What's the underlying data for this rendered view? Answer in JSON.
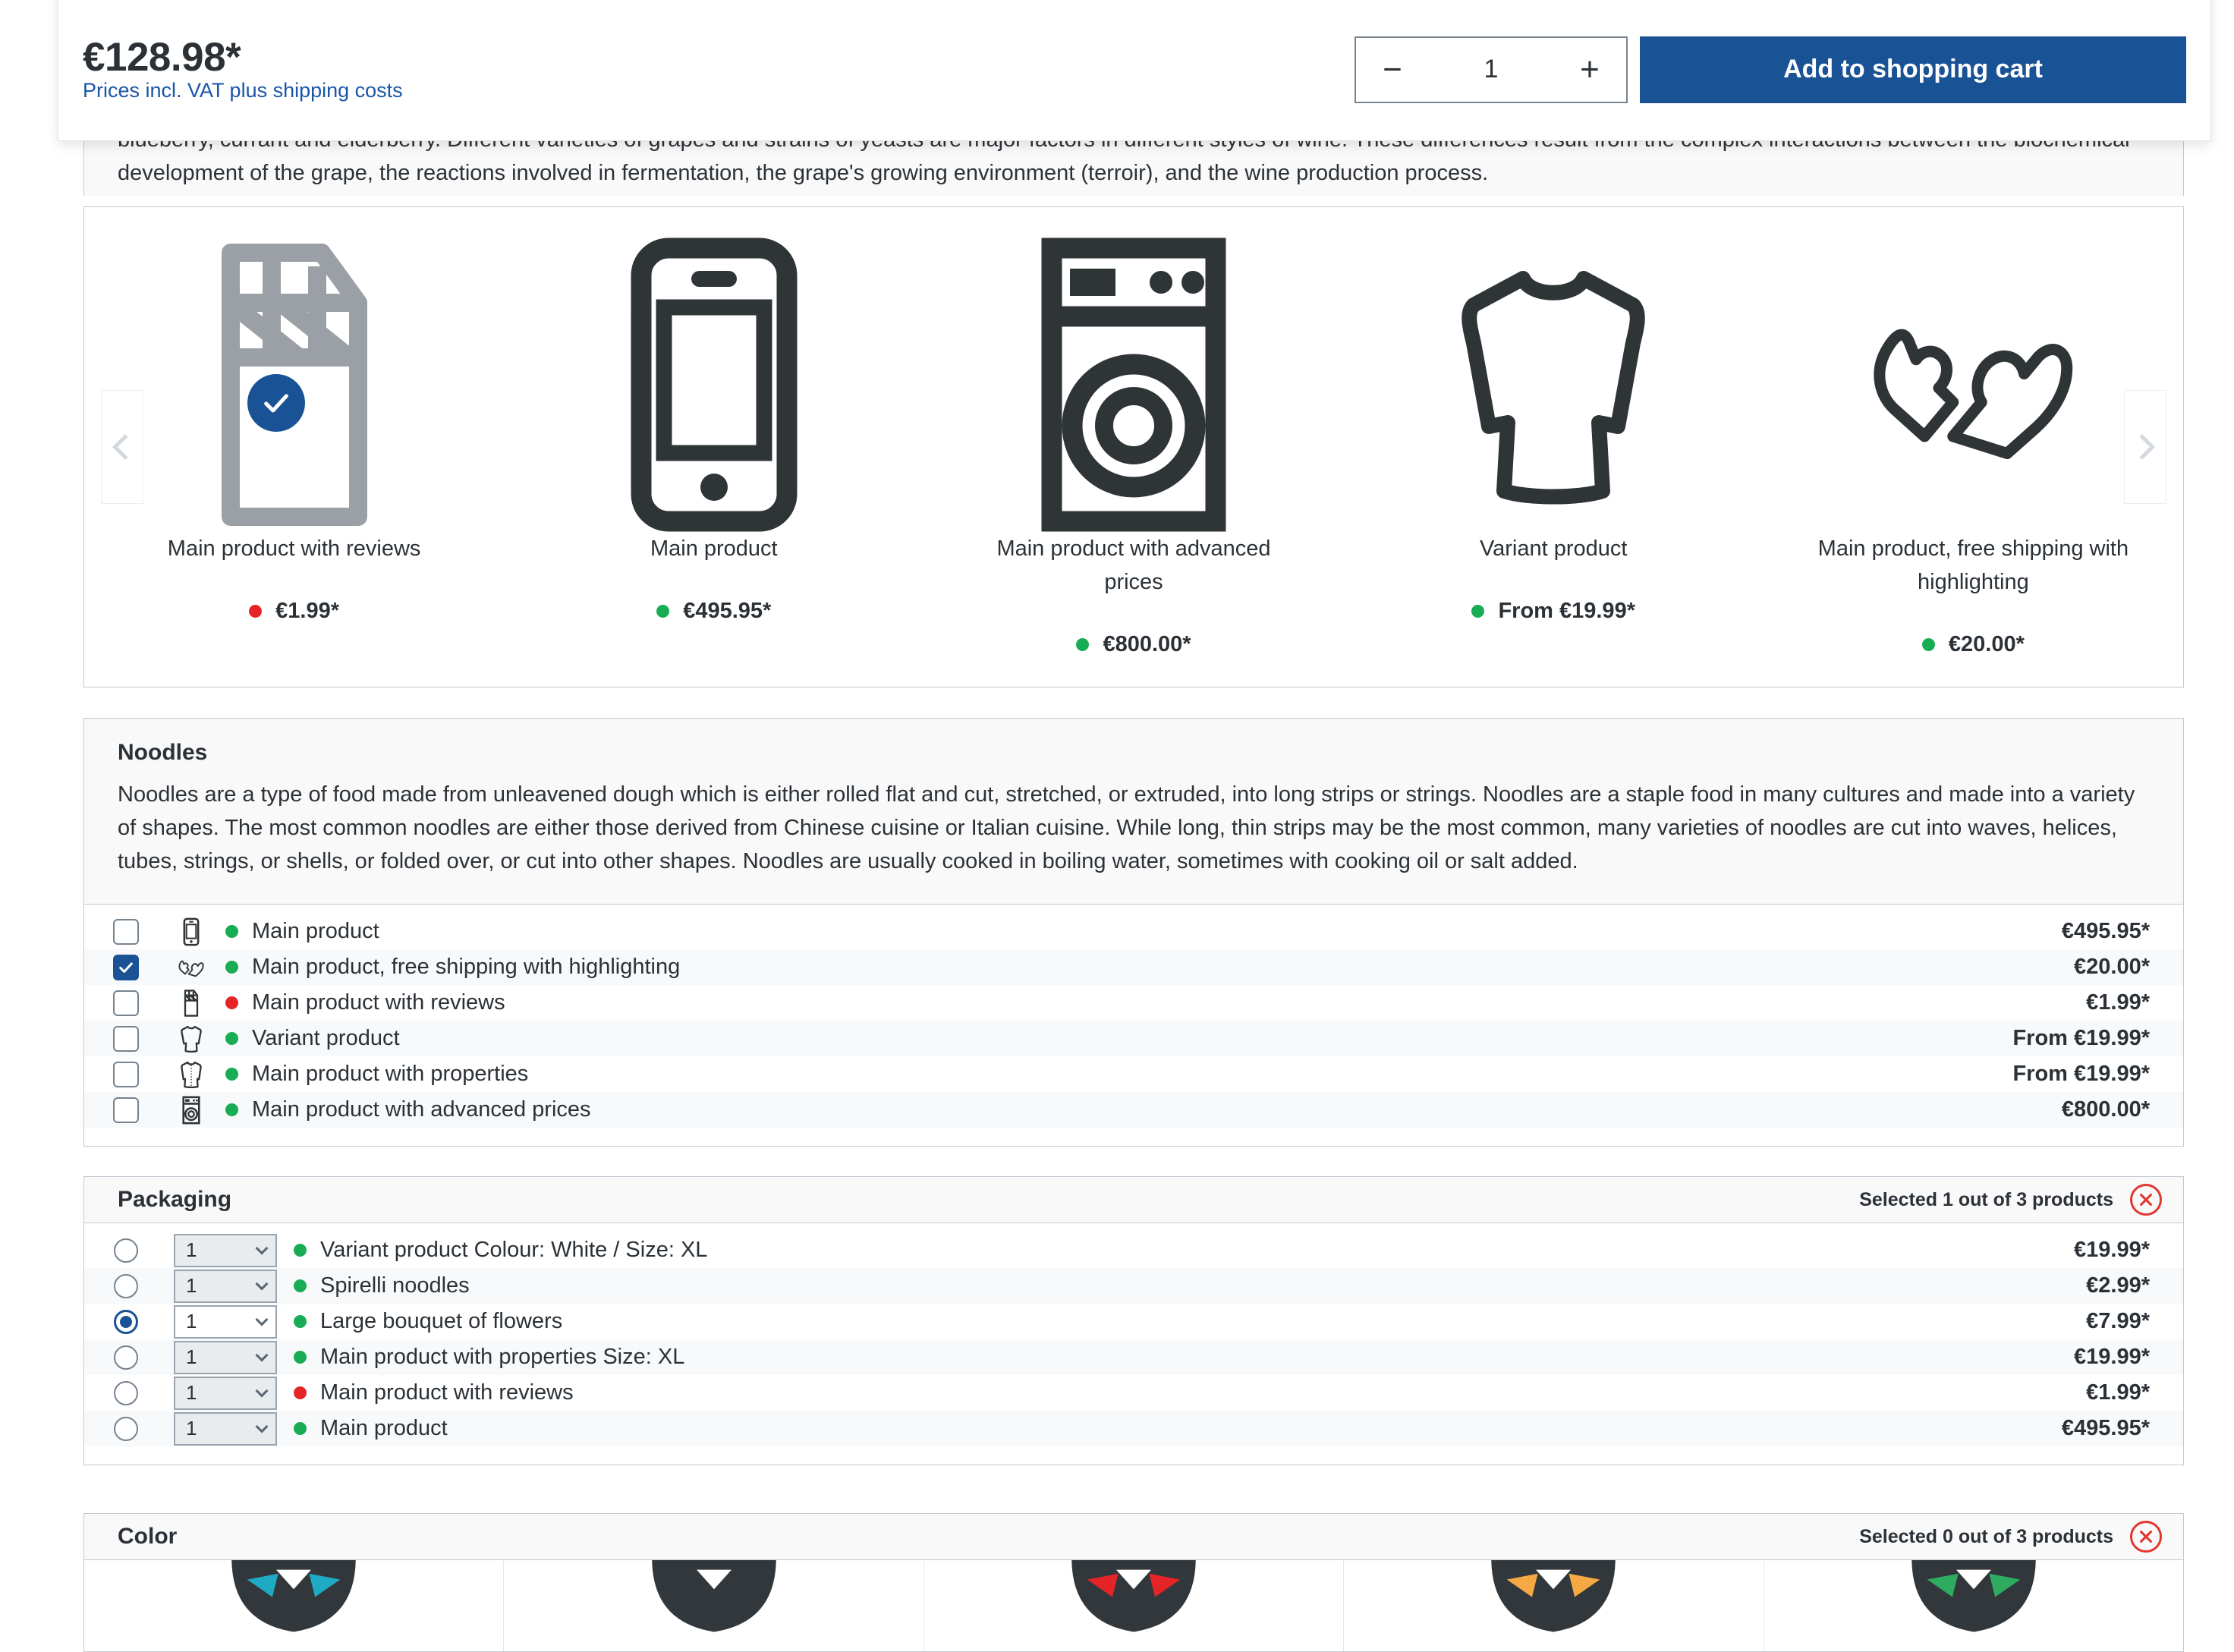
{
  "buybox": {
    "price": "€128.98*",
    "price_note": "Prices incl. VAT plus shipping costs",
    "qty_minus": "−",
    "qty_value": "1",
    "qty_plus": "+",
    "add_to_cart_label": "Add to shopping cart"
  },
  "wine_text": {
    "line1": "blueberry, currant and elderberry. Different varieties of grapes and strains of yeasts are major factors in different styles of wine. These differences result from the complex interactions between the",
    "line2": "biochemical development of the grape, the reactions involved in fermentation, the grape's growing environment (terroir), and the wine production process."
  },
  "carousel": {
    "prev_label": "Previous",
    "next_label": "Next",
    "items": [
      {
        "icon": "chocolate-bar-icon",
        "title": "Main product with reviews",
        "price": "€1.99*",
        "status": "red",
        "selected": true
      },
      {
        "icon": "smartphone-icon",
        "title": "Main product",
        "price": "€495.95*",
        "status": "green",
        "selected": false
      },
      {
        "icon": "washing-machine-icon",
        "title": "Main product with advanced prices",
        "price": "€800.00*",
        "status": "green",
        "selected": false
      },
      {
        "icon": "sweater-icon",
        "title": "Variant product",
        "price": "From €19.99*",
        "status": "green",
        "selected": false
      },
      {
        "icon": "mittens-icon",
        "title": "Main product, free shipping with highlighting",
        "price": "€20.00*",
        "status": "green",
        "selected": false
      }
    ]
  },
  "noodles": {
    "title": "Noodles",
    "description": "Noodles are a type of food made from unleavened dough which is either rolled flat and cut, stretched, or extruded, into long strips or strings. Noodles are a staple food in many cultures and made into a variety of shapes. The most common noodles are either those derived from Chinese cuisine or Italian cuisine. While long, thin strips may be the most common, many varieties of noodles are cut into waves, helices, tubes, strings, or shells, or folded over, or cut into other shapes. Noodles are usually cooked in boiling water, sometimes with cooking oil or salt added.",
    "rows": [
      {
        "checked": false,
        "icon": "smartphone-icon",
        "status": "green",
        "label": "Main product",
        "price": "€495.95*"
      },
      {
        "checked": true,
        "icon": "mittens-icon",
        "status": "green",
        "label": "Main product, free shipping with highlighting",
        "price": "€20.00*"
      },
      {
        "checked": false,
        "icon": "chocolate-bar-icon",
        "status": "red",
        "label": "Main product with reviews",
        "price": "€1.99*"
      },
      {
        "checked": false,
        "icon": "sweater-icon",
        "status": "green",
        "label": "Variant product",
        "price": "From €19.99*"
      },
      {
        "checked": false,
        "icon": "shirt-icon",
        "status": "green",
        "label": "Main product with properties",
        "price": "From €19.99*"
      },
      {
        "checked": false,
        "icon": "washing-machine-icon",
        "status": "green",
        "label": "Main product with advanced prices",
        "price": "€800.00*"
      }
    ]
  },
  "packaging": {
    "title": "Packaging",
    "selected_text": "Selected 1 out of 3 products",
    "clear_label": "Clear selection",
    "rows": [
      {
        "selected": false,
        "qty": "1",
        "status": "green",
        "label": "Variant product Colour: White / Size: XL",
        "price": "€19.99*"
      },
      {
        "selected": false,
        "qty": "1",
        "status": "green",
        "label": "Spirelli noodles",
        "price": "€2.99*"
      },
      {
        "selected": true,
        "qty": "1",
        "status": "green",
        "label": "Large bouquet of flowers",
        "price": "€7.99*"
      },
      {
        "selected": false,
        "qty": "1",
        "status": "green",
        "label": "Main product with properties Size: XL",
        "price": "€19.99*"
      },
      {
        "selected": false,
        "qty": "1",
        "status": "red",
        "label": "Main product with reviews",
        "price": "€1.99*"
      },
      {
        "selected": false,
        "qty": "1",
        "status": "green",
        "label": "Main product",
        "price": "€495.95*"
      }
    ]
  },
  "color": {
    "title": "Color",
    "selected_text": "Selected 0 out of 3 products",
    "clear_label": "Clear selection",
    "tiles": [
      {
        "icon": "cat-icon",
        "accent": "#1eaac4"
      },
      {
        "icon": "cat-icon",
        "accent": "#32373b"
      },
      {
        "icon": "cat-icon",
        "accent": "#e52427"
      },
      {
        "icon": "cat-icon",
        "accent": "#f5a944"
      },
      {
        "icon": "cat-icon",
        "accent": "#2fab5f"
      }
    ]
  },
  "colors": {
    "brand": "#1a5296",
    "link": "#1a56a8",
    "in_stock": "#18ad54",
    "out_stock": "#e52427",
    "danger": "#e2372e"
  }
}
